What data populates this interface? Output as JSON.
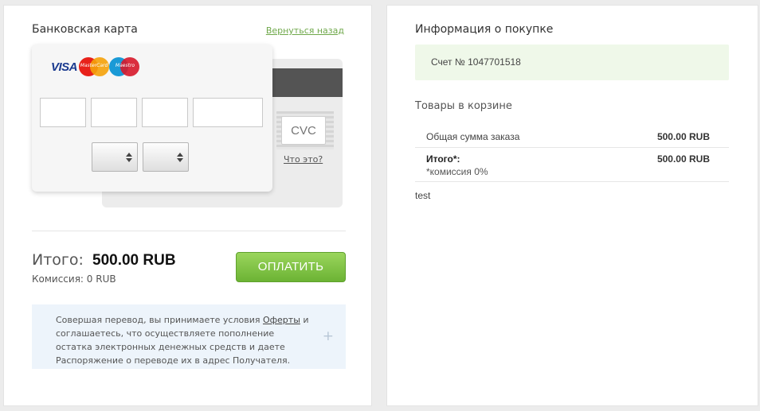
{
  "payment": {
    "title": "Банковская карта",
    "back_link": "Вернуться назад",
    "card_logos": {
      "visa": "VISA",
      "mastercard": "MasterCard",
      "maestro": "Maestro"
    },
    "cvc_placeholder": "CVC",
    "cvc_help": "Что это?",
    "total_label": "Итого:",
    "total_value": "500.00 RUB",
    "commission": "Комиссия: 0 RUB",
    "pay_button": "ОПЛАТИТЬ",
    "offer": {
      "before": "Совершая перевод, вы принимаете условия ",
      "link": "Оферты",
      "after": " и соглашаетесь, что осуществляете пополнение остатка электронных денежных средств и даете Распоряжение о переводе их в адрес Получателя."
    },
    "expand_symbol": "+"
  },
  "purchase": {
    "title": "Информация о покупке",
    "invoice": "Счет № 1047701518",
    "cart_title": "Товары в корзине",
    "rows": [
      {
        "label": "Общая сумма заказа",
        "value": "500.00 RUB"
      },
      {
        "label": "Итого*:",
        "value": "500.00 RUB",
        "note": "*комиссия 0%"
      }
    ],
    "description": "test"
  },
  "colors": {
    "accent_green": "#6cb334",
    "link_green": "#6fa84a",
    "invoice_bg": "#eff8e9",
    "offer_bg": "#edf4fb"
  }
}
